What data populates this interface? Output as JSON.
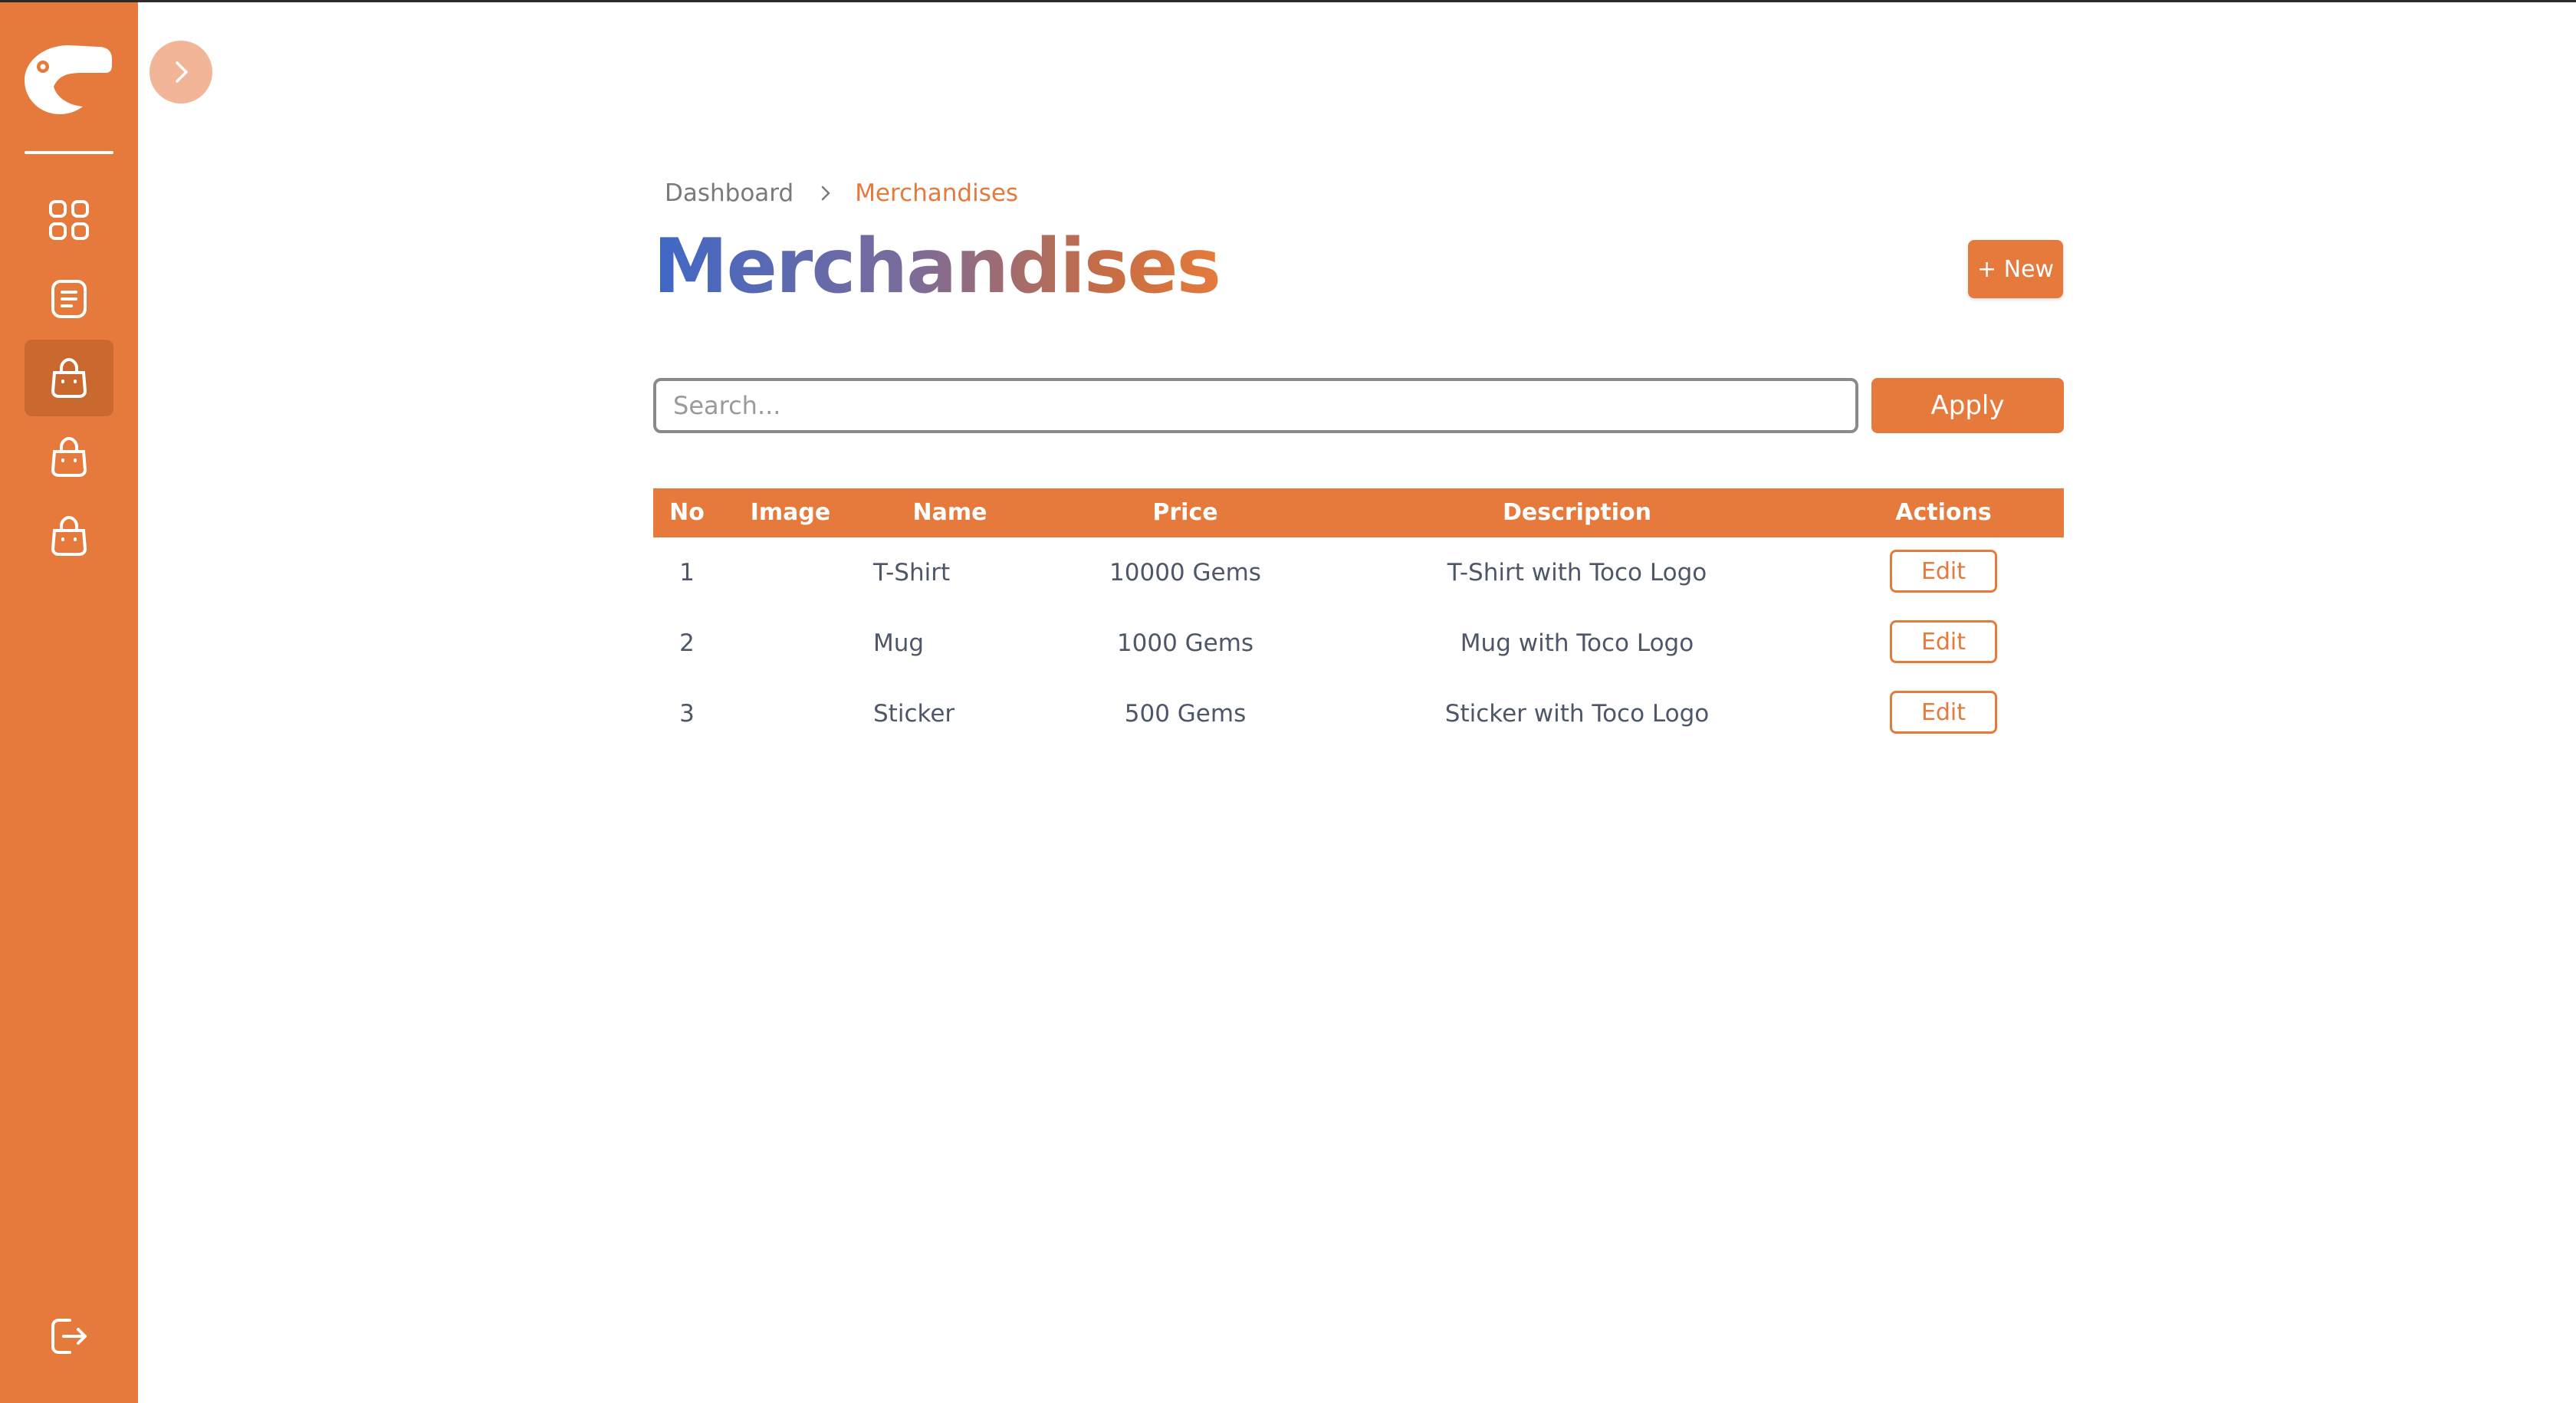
{
  "sidebar": {
    "items": [
      {
        "icon": "grid-icon",
        "name": "dashboard"
      },
      {
        "icon": "document-icon",
        "name": "posts"
      },
      {
        "icon": "shopping-bag-icon",
        "name": "merchandises",
        "active": true
      },
      {
        "icon": "shopping-bag-icon",
        "name": "shop-2"
      },
      {
        "icon": "shopping-bag-icon",
        "name": "shop-3"
      }
    ],
    "logout_icon": "logout-icon",
    "logo_icon": "toucan-logo-icon"
  },
  "toggle_icon": "chevron-right-icon",
  "breadcrumb": {
    "parent": "Dashboard",
    "current": "Merchandises"
  },
  "page_title": "Merchandises",
  "new_button_label": "+ New",
  "search": {
    "placeholder": "Search...",
    "value": "",
    "apply_label": "Apply"
  },
  "table": {
    "headers": {
      "no": "No",
      "image": "Image",
      "name": "Name",
      "price": "Price",
      "description": "Description",
      "actions": "Actions"
    },
    "rows": [
      {
        "no": "1",
        "name": "T-Shirt",
        "price": "10000 Gems",
        "description": "T-Shirt with Toco Logo",
        "action": "Edit"
      },
      {
        "no": "2",
        "name": "Mug",
        "price": "1000 Gems",
        "description": "Mug with Toco Logo",
        "action": "Edit"
      },
      {
        "no": "3",
        "name": "Sticker",
        "price": "500 Gems",
        "description": "Sticker with Toco Logo",
        "action": "Edit"
      }
    ]
  },
  "colors": {
    "accent": "#e57a3c",
    "sidebar_active": "#c9692f",
    "toggle_bg": "#f2b597",
    "title_gradient_start": "#3f67c7",
    "title_gradient_end": "#e57a3c",
    "text": "#4e5768"
  }
}
